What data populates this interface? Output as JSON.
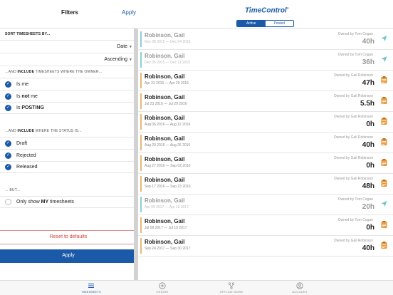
{
  "filters": {
    "title": "Filters",
    "apply_link": "Apply",
    "sort_label": "SORT TIMESHEETS BY...",
    "sort_field": "Date",
    "sort_order": "Ascending",
    "owner_label_pre": "...AND ",
    "owner_label_bold": "INCLUDE",
    "owner_label_post": " TIMESHEETS WHERE THE OWNER...",
    "owner_options": [
      {
        "pre": "Is me",
        "bold": "",
        "post": "",
        "checked": true
      },
      {
        "pre": "Is ",
        "bold": "not",
        "post": " me",
        "checked": true
      },
      {
        "pre": "Is ",
        "bold": "POSTING",
        "post": "",
        "checked": true
      }
    ],
    "status_label_pre": "...AND ",
    "status_label_bold": "INCLUDE",
    "status_label_post": " WHERE THE STATUS IS...",
    "status_options": [
      {
        "label": "Draft",
        "checked": true
      },
      {
        "label": "Rejected",
        "checked": true
      },
      {
        "label": "Released",
        "checked": true
      }
    ],
    "but_label": "... BUT...",
    "my_only_pre": "Only show ",
    "my_only_bold": "MY",
    "my_only_post": " timesheets",
    "reset_label": "Reset to defaults",
    "apply_button": "Apply"
  },
  "header": {
    "brand": "TimeControl",
    "brand_tm": "®",
    "seg_active": "Active",
    "seg_posted": "Posted"
  },
  "colors": {
    "accent": "#1a5aa8",
    "bar_draft": "#e8b877",
    "bar_posting": "#8fcfd9",
    "icon_orange": "#e8973a",
    "icon_teal": "#6fc3cf",
    "reset_red": "#d43c3c"
  },
  "timesheets": [
    {
      "name": "Robinson, Gail",
      "dates": "Nov 28 2015 — Dec 04 2015",
      "owner": "Owned by Tom Cogan",
      "hours": "40h",
      "status": "posting",
      "icon": "send-icon"
    },
    {
      "name": "Robinson, Gail",
      "dates": "Dec 05 2015 — Dec 11 2015",
      "owner": "Owned by Tom Cogan",
      "hours": "36h",
      "status": "posting",
      "icon": "send-icon"
    },
    {
      "name": "Robinson, Gail",
      "dates": "Apr 23 2016 — Apr 29 2016",
      "owner": "Owned by Gail Robinson",
      "hours": "47h",
      "status": "draft",
      "icon": "clipboard-icon"
    },
    {
      "name": "Robinson, Gail",
      "dates": "Jul 23 2016 — Jul 29 2016",
      "owner": "Owned by Gail Robinson",
      "hours": "5.5h",
      "status": "draft",
      "icon": "clipboard-icon"
    },
    {
      "name": "Robinson, Gail",
      "dates": "Aug 06 2016 — Aug 12 2016",
      "owner": "Owned by Gail Robinson",
      "hours": "0h",
      "status": "draft",
      "icon": "clipboard-icon"
    },
    {
      "name": "Robinson, Gail",
      "dates": "Aug 20 2016 — Aug 26 2016",
      "owner": "Owned by Gail Robinson",
      "hours": "40h",
      "status": "draft",
      "icon": "clipboard-icon"
    },
    {
      "name": "Robinson, Gail",
      "dates": "Aug 27 2016 — Sep 02 2016",
      "owner": "Owned by Gail Robinson",
      "hours": "0h",
      "status": "draft",
      "icon": "clipboard-icon"
    },
    {
      "name": "Robinson, Gail",
      "dates": "Sep 17 2016 — Sep 23 2016",
      "owner": "Owned by Gail Robinson",
      "hours": "48h",
      "status": "draft",
      "icon": "clipboard-icon"
    },
    {
      "name": "Robinson, Gail",
      "dates": "Apr 09 2017 — Apr 15 2017",
      "owner": "Owned by Tom Cogan",
      "hours": "20h",
      "status": "posting",
      "icon": "send-icon"
    },
    {
      "name": "Robinson, Gail",
      "dates": "Jul 09 2017 — Jul 15 2017",
      "owner": "Owned by Tom Cogan",
      "hours": "0h",
      "status": "draft",
      "icon": "clipboard-icon"
    },
    {
      "name": "Robinson, Gail",
      "dates": "Sep 24 2017 — Sep 30 2017",
      "owner": "Owned by Gail Robinson",
      "hours": "40h",
      "status": "draft",
      "icon": "clipboard-icon"
    }
  ],
  "tabs": [
    {
      "label": "TIMESHEETS",
      "icon": "menu-icon",
      "active": true
    },
    {
      "label": "CREATE",
      "icon": "plus-circle-icon",
      "active": false
    },
    {
      "label": "OFFLINE WORK",
      "icon": "flow-icon",
      "active": false
    },
    {
      "label": "ACCOUNT",
      "icon": "user-icon",
      "active": false
    }
  ]
}
